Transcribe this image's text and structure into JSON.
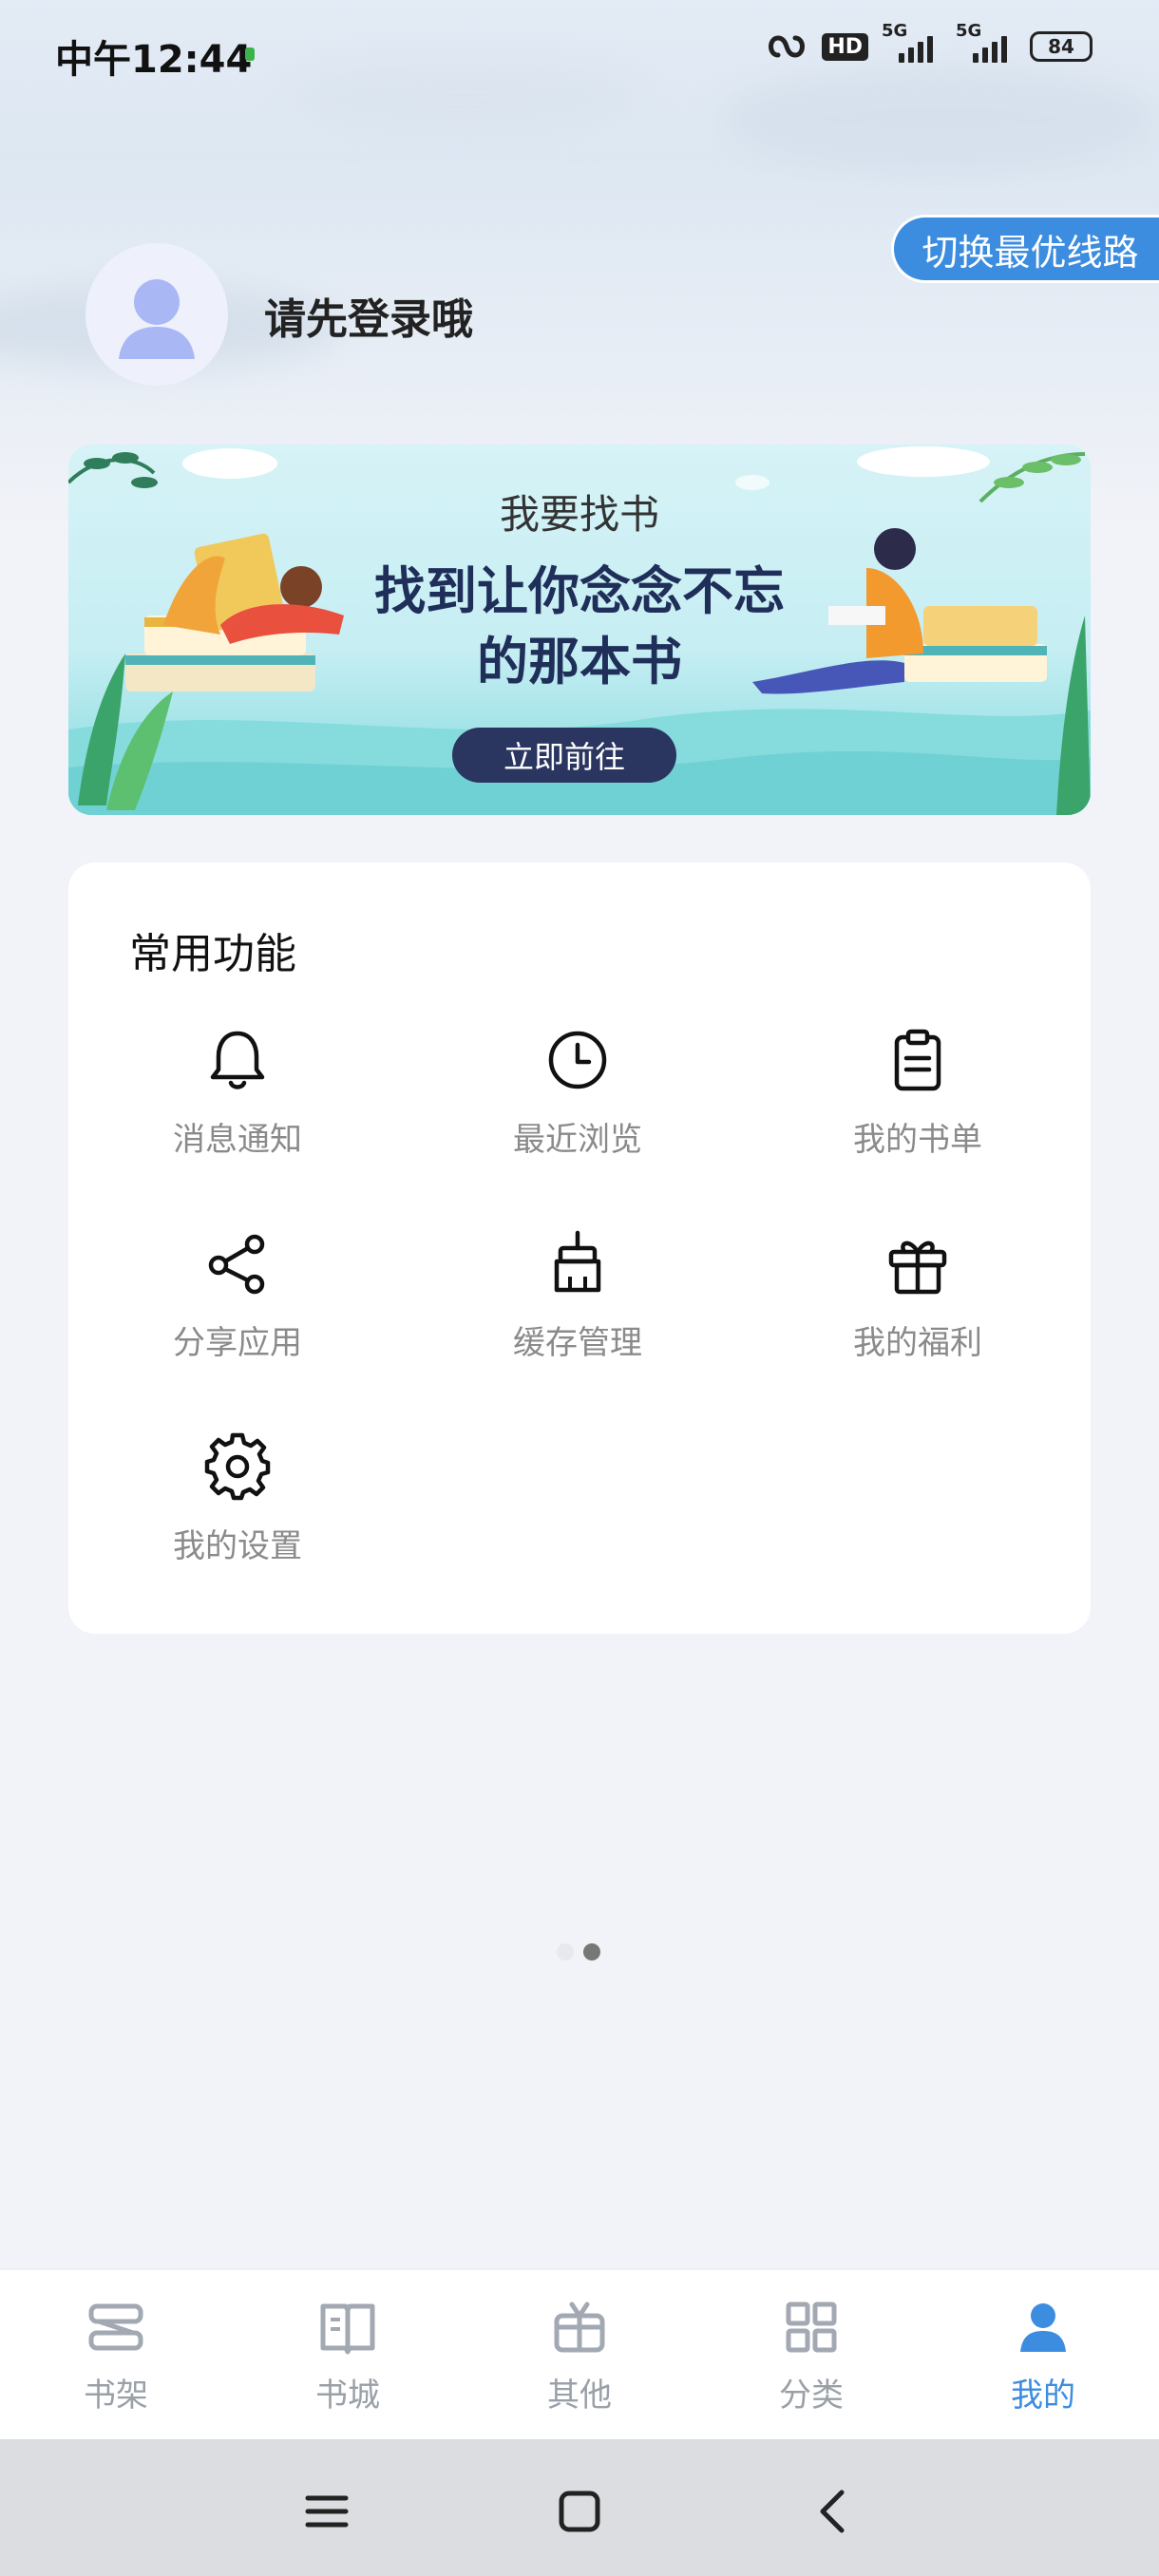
{
  "status_bar": {
    "time": "中午12:44",
    "hd": "HD",
    "signal1_label": "5G",
    "signal2_label": "5G",
    "battery": "84"
  },
  "header": {
    "switch_line_label": "切换最优线路",
    "login_prompt": "请先登录哦"
  },
  "banner": {
    "title": "我要找书",
    "slogan_line1": "找到让你念念不忘",
    "slogan_line2": "的那本书",
    "cta_label": "立即前往"
  },
  "features": {
    "title": "常用功能",
    "items": [
      {
        "label": "消息通知",
        "icon": "bell-icon"
      },
      {
        "label": "最近浏览",
        "icon": "clock-icon"
      },
      {
        "label": "我的书单",
        "icon": "clipboard-icon"
      },
      {
        "label": "分享应用",
        "icon": "share-icon"
      },
      {
        "label": "缓存管理",
        "icon": "broom-icon"
      },
      {
        "label": "我的福利",
        "icon": "gift-icon"
      },
      {
        "label": "我的设置",
        "icon": "gear-icon"
      }
    ]
  },
  "bottom_nav": {
    "items": [
      {
        "label": "书架",
        "icon": "bookshelf-icon",
        "active": false
      },
      {
        "label": "书城",
        "icon": "open-book-icon",
        "active": false
      },
      {
        "label": "其他",
        "icon": "gift-box-icon",
        "active": false
      },
      {
        "label": "分类",
        "icon": "grid-icon",
        "active": false
      },
      {
        "label": "我的",
        "icon": "person-icon",
        "active": true
      }
    ]
  },
  "colors": {
    "accent": "#3c8ce0",
    "inactive": "#9aa0a8",
    "banner_button": "#2a3560"
  }
}
